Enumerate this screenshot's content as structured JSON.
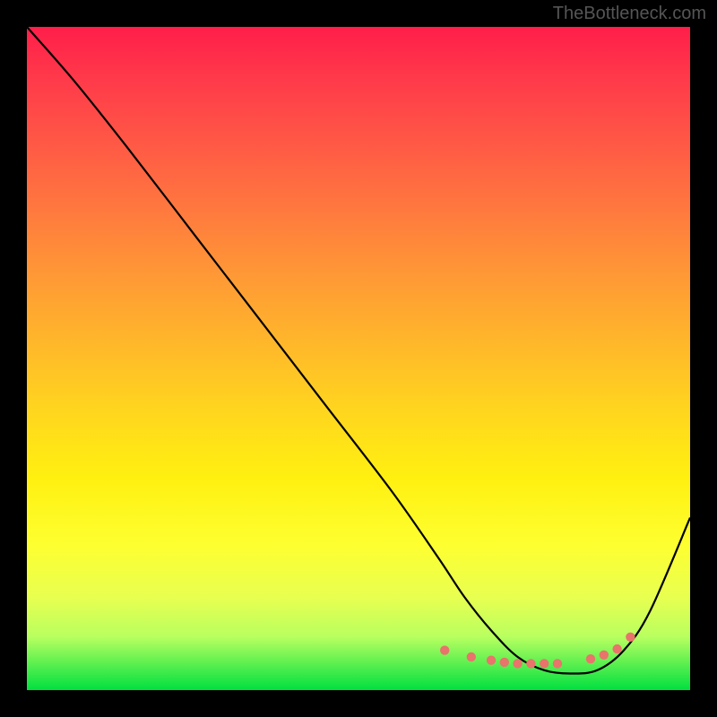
{
  "watermark": "TheBottleneck.com",
  "chart_data": {
    "type": "line",
    "title": "",
    "xlabel": "",
    "ylabel": "",
    "xlim": [
      0,
      100
    ],
    "ylim": [
      0,
      100
    ],
    "series": [
      {
        "name": "curve",
        "x": [
          0,
          7,
          15,
          25,
          35,
          45,
          55,
          62,
          66,
          70,
          74,
          78,
          82,
          86,
          90,
          94,
          100
        ],
        "y": [
          100,
          92,
          82,
          69,
          56,
          43,
          30,
          20,
          14,
          9,
          5,
          3,
          2.5,
          3,
          6,
          12,
          26
        ]
      }
    ],
    "highlight_dots": {
      "x": [
        63,
        67,
        70,
        72,
        74,
        76,
        78,
        80,
        85,
        87,
        89,
        91
      ],
      "y": [
        6,
        5,
        4.5,
        4.2,
        4,
        4,
        4,
        4,
        4.7,
        5.3,
        6.2,
        8
      ]
    },
    "gradient_colors": [
      "#ff1e4a",
      "#ff7a3e",
      "#ffd61e",
      "#feff30",
      "#00e040"
    ]
  }
}
